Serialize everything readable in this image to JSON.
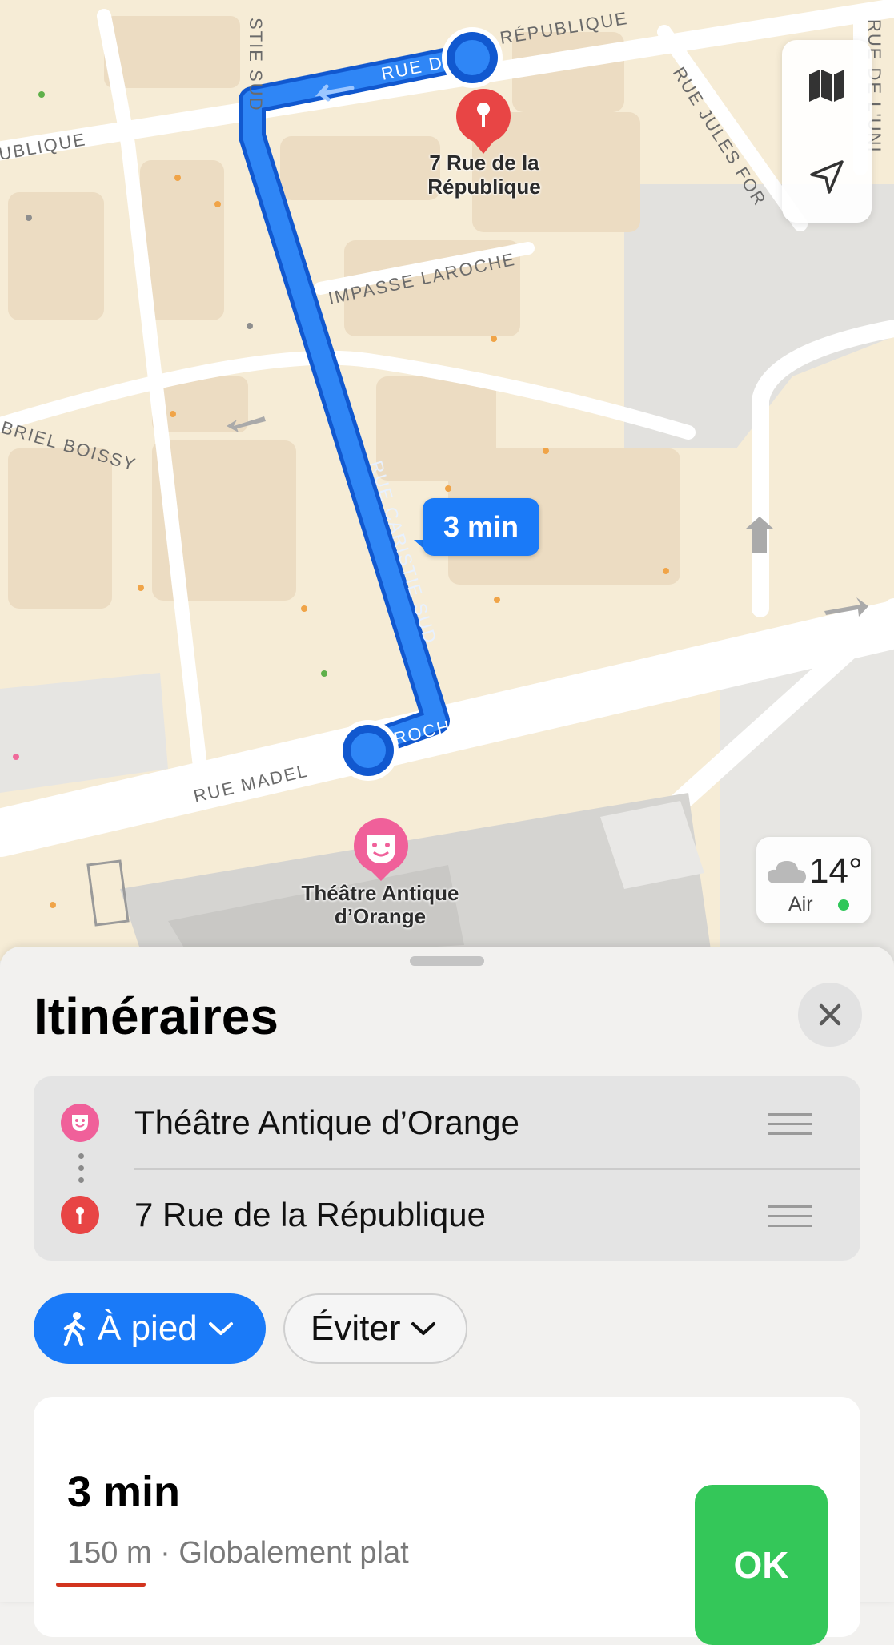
{
  "map": {
    "streets": {
      "top_republique": "RÉPUBLIQUE",
      "rue_de": "RUE D",
      "republique_left": "UBLIQUE",
      "caristie_top": "STIE SUD",
      "rue_jules": "RUE JULES FOR",
      "rue_de_l_right": "RUE DE L'UNI",
      "impasse": "IMPASSE LAROCHE",
      "gabriel": "BRIEL BOISSY",
      "caristie": "RUE CARISTIE SUD",
      "madeleine": "RUE MADEL",
      "roch": "ROCH"
    },
    "destination_label_line1": "7 Rue de la",
    "destination_label_line2": "République",
    "origin_label_line1": "Théâtre Antique",
    "origin_label_line2": "d’Orange",
    "route_time_bubble": "3 min",
    "route_color": "#1a7af8",
    "controls": {
      "map_icon": "map-icon",
      "location_icon": "location-arrow-icon"
    },
    "weather": {
      "temperature": "14°",
      "air_label": "Air",
      "air_status_color": "#30c75a"
    }
  },
  "sheet": {
    "title": "Itinéraires",
    "close_icon": "close-icon",
    "route": {
      "from": "Théâtre Antique d’Orange",
      "to": "7 Rue de la République"
    },
    "mode_chip": "À pied",
    "avoid_chip": "Éviter",
    "result": {
      "time": "3 min",
      "distance": "150 m",
      "separator": " · ",
      "terrain": "Globalement plat",
      "go_label": "OK"
    },
    "colors": {
      "accent": "#1a7af8",
      "go": "#34c759",
      "theatre_pin": "#f0609a",
      "destination_pin": "#e84545"
    }
  }
}
